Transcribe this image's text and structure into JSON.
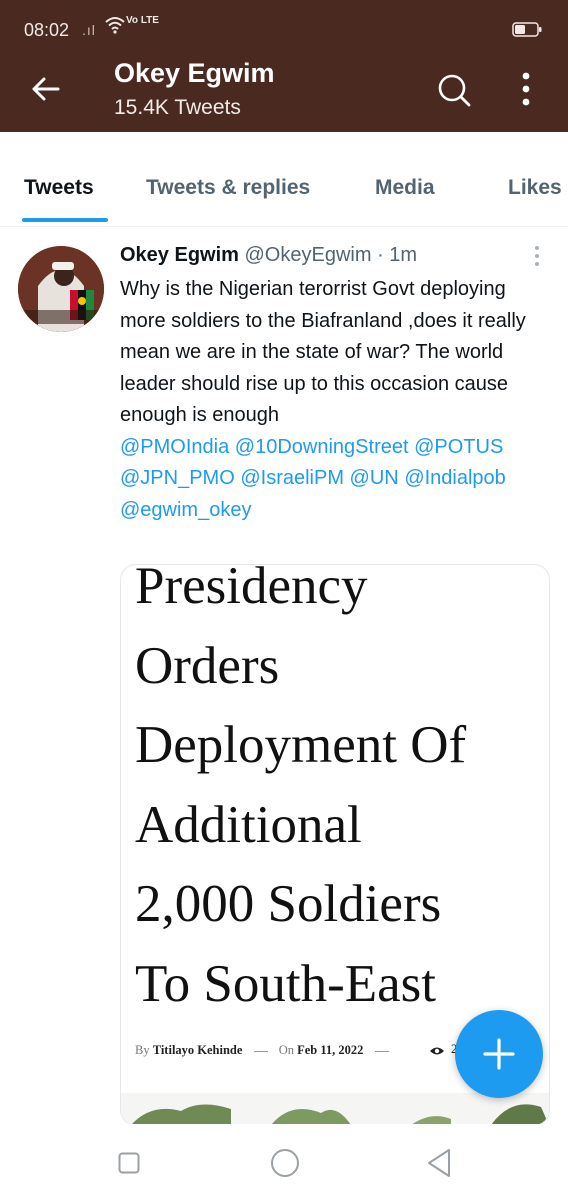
{
  "status_bar": {
    "time": "08:02",
    "network": "Vo LTE"
  },
  "header": {
    "name": "Okey Egwim",
    "tweet_count": "15.4K Tweets"
  },
  "tabs": [
    {
      "label": "Tweets",
      "active": true
    },
    {
      "label": "Tweets & replies",
      "active": false
    },
    {
      "label": "Media",
      "active": false
    },
    {
      "label": "Likes",
      "active": false
    }
  ],
  "tweet": {
    "author": "Okey Egwim",
    "handle": "@OkeyEgwim",
    "separator": "·",
    "time": "1m",
    "text": "Why is the Nigerian terorrist Govt deploying more soldiers to the Biafranland ,does it really mean we are in the state of war? The world leader should rise up to this occasion cause enough is enough",
    "mentions": [
      "@PMOIndia",
      "@10DowningStreet",
      "@POTUS",
      "@JPN_PMO",
      "@IsraeliPM",
      "@UN",
      "@Indialpob",
      "@egwim_okey"
    ],
    "media": {
      "headline_lines": [
        "Presidency",
        "Orders",
        "Deployment Of",
        "Additional",
        "2,000 Soldiers",
        "To South-East"
      ],
      "by_prefix": "By",
      "author": "Titilayo Kehinde",
      "date_prefix": "On",
      "date": "Feb 11, 2022",
      "views": "2"
    }
  },
  "colors": {
    "header_bg": "#4a2a20",
    "accent": "#1d9bf0",
    "text_primary": "#0f1419",
    "text_secondary": "#536471"
  },
  "icons": {
    "back": "arrow-left-icon",
    "search": "search-icon",
    "more": "more-vertical-icon",
    "compose": "plus-icon"
  }
}
